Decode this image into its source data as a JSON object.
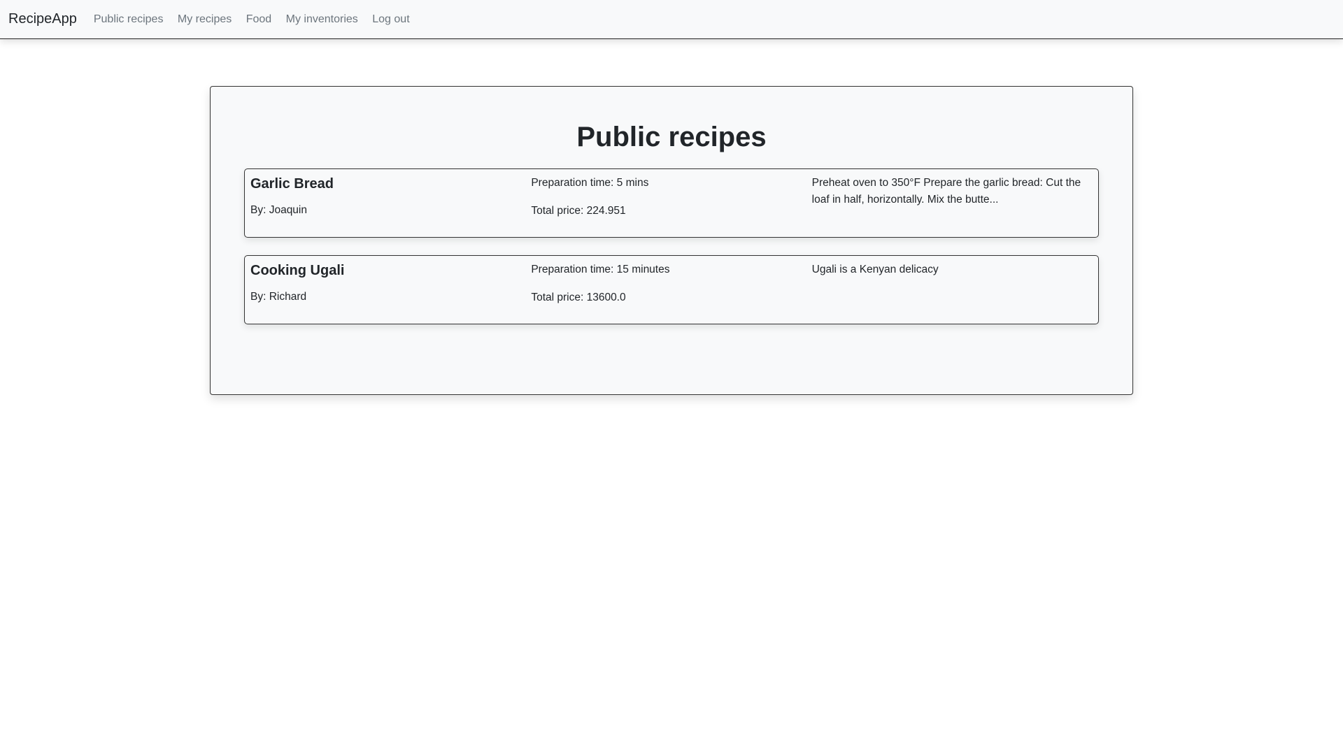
{
  "navbar": {
    "brand": "RecipeApp",
    "links": [
      "Public recipes",
      "My recipes",
      "Food",
      "My inventories",
      "Log out"
    ]
  },
  "page_title": "Public recipes",
  "recipes": [
    {
      "name": "Garlic Bread",
      "author": "By: Joaquin",
      "prep_time": "Preparation time: 5 mins",
      "total_price": "Total price: 224.951",
      "description": "Preheat oven to 350°F Prepare the garlic bread: Cut the loaf in half, horizontally. Mix the butte..."
    },
    {
      "name": "Cooking Ugali",
      "author": "By: Richard",
      "prep_time": "Preparation time: 15 minutes",
      "total_price": "Total price: 13600.0",
      "description": "Ugali is a Kenyan delicacy"
    }
  ]
}
